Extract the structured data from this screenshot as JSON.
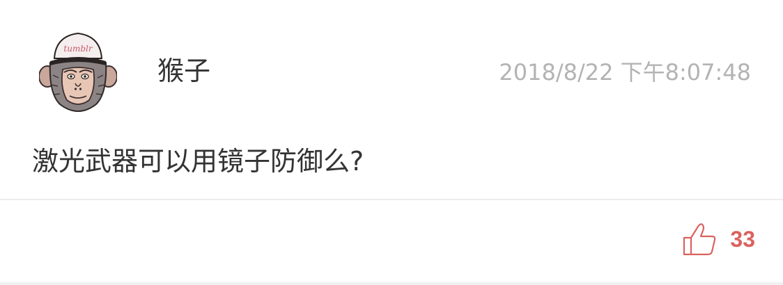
{
  "comment": {
    "username": "猴子",
    "timestamp": "2018/8/22 下午8:07:48",
    "text": "激光武器可以用镜子防御么?",
    "likes": "33",
    "avatar_cap_text": "tumblr"
  },
  "colors": {
    "username": "#333333",
    "timestamp": "#b3b3b3",
    "like_accent": "#d9625e",
    "divider": "#ececec"
  },
  "icons": {
    "avatar": "monkey-in-cap-avatar",
    "like": "thumbs-up-icon"
  }
}
